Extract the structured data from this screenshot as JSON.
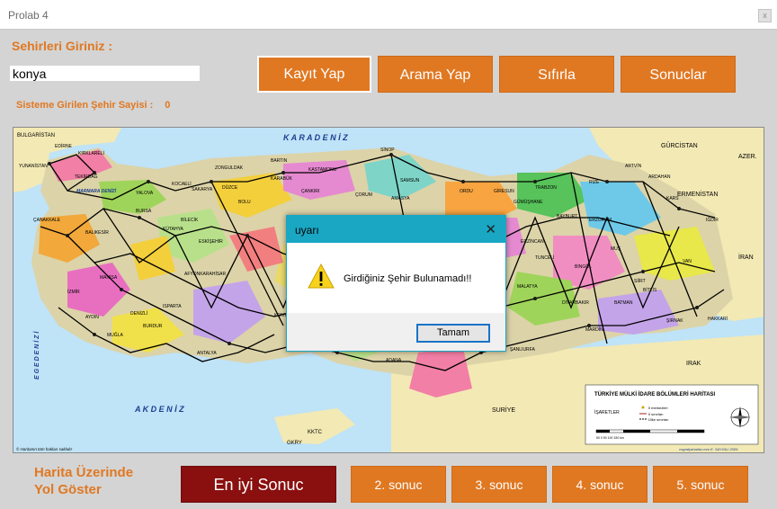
{
  "window": {
    "title": "Prolab 4",
    "close_glyph": "x"
  },
  "form": {
    "cities_label": "Sehirleri Giriniz :",
    "city_input_value": "konya",
    "count_label": "Sisteme Girilen Şehir Sayisi :",
    "count_value": "0"
  },
  "toolbar": {
    "kayit": "Kayıt Yap",
    "arama": "Arama Yap",
    "sifirla": "Sıfırla",
    "sonuclar": "Sonuclar"
  },
  "map": {
    "seas": {
      "north": "K A R A D E N İ Z",
      "south": "A K D E N İ Z",
      "west": "E G E  D E N İ Z İ",
      "marmara": "MARMARA DENİZİ"
    },
    "countries": [
      "BULGARİSTAN",
      "YUNANİSTAN",
      "GÜRCİSTAN",
      "AZER.",
      "ERMENİSTAN",
      "İRAN",
      "IRAK",
      "SURİYE",
      "KKTC",
      "GKRY"
    ],
    "cities": [
      "EDİRNE",
      "KIRKLARELİ",
      "TEKİRDAĞ",
      "ÇANAKKALE",
      "BALIKESİR",
      "BARTIN",
      "ZONGULDAK",
      "KASTAMONU",
      "SİNOP",
      "SAMSUN",
      "ARTVİN",
      "ARDAHAN",
      "KARS",
      "IĞDIR",
      "BAYBURT",
      "ERZİNCAN",
      "TUNCELİ",
      "BİNGÖL",
      "BİTLİS",
      "HAKKARİ",
      "MARDİN",
      "ŞANLIURFA",
      "DİYARBAKIR",
      "ADANA",
      "ANTALYA",
      "MUĞLA",
      "AYDIN",
      "İZMİR",
      "MANİSA",
      "KÜTAHYA",
      "DENİZLİ",
      "AFYONKARAHİSAR",
      "ESKİŞEHİR",
      "ISPARTA",
      "KONYA",
      "BURDUR",
      "ÇORUM",
      "AMASYA",
      "ORDU",
      "GİRESUN",
      "TRABZON",
      "RİZE",
      "GÜMÜŞHANE",
      "ERZURUM",
      "MUŞ",
      "MALATYA",
      "BATMAN",
      "SİİRT",
      "ŞIRNAK",
      "VAN",
      "ÇANKIRI",
      "KARABÜK",
      "DÜZCE",
      "BOLU",
      "SAKARYA",
      "KOCAELİ",
      "YALOVA",
      "BURSA",
      "BİLECİK"
    ],
    "legend": {
      "title": "TÜRKİYE MÜLKİ İDARE BÖLÜMLERİ HARİTASI",
      "isaretler": "İŞARETLER",
      "item1": "İl merkezleri",
      "item2": "İl sınırları",
      "item3": "Ülke sınırları",
      "scale": "50 0 50 100 150 km"
    },
    "copyright_left": "© Haritanın tüm hakları saklıdır",
    "copyright_right": "cografyaharita.com  E. SAYGILI 2009"
  },
  "dialog": {
    "title": "uyarı",
    "message": "Girdiğiniz Şehir Bulunamadı!!",
    "ok": "Tamam",
    "close_glyph": "✕"
  },
  "bottom": {
    "label_line1": "Harita Üzerinde",
    "label_line2": "Yol Göster",
    "best": "En iyi Sonuc",
    "r2": "2. sonuc",
    "r3": "3. sonuc",
    "r4": "4. sonuc",
    "r5": "5. sonuc"
  },
  "colors": {
    "accent": "#e07822",
    "best_result": "#8a0f0f",
    "dialog_title": "#19a7c4"
  }
}
